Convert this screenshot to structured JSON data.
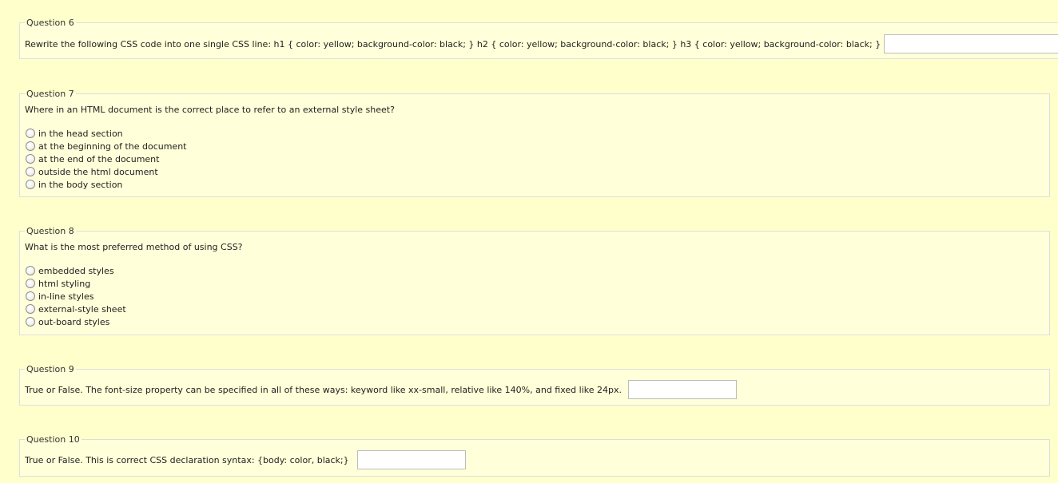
{
  "questions": {
    "q6": {
      "legend": "Question 6",
      "text": "Rewrite the following CSS code into one single CSS line: h1 { color: yellow; background-color: black; } h2 { color: yellow; background-color: black; } h3 { color: yellow; background-color: black; }",
      "answer": ""
    },
    "q7": {
      "legend": "Question 7",
      "text": "Where in an HTML document is the correct place to refer to an external style sheet?",
      "options": [
        "in the head section",
        "at the beginning of the document",
        "at the end of the document",
        "outside the html document",
        "in the body section"
      ]
    },
    "q8": {
      "legend": "Question 8",
      "text": "What is the most preferred method of using CSS?",
      "options": [
        "embedded styles",
        "html styling",
        "in-line styles",
        "external-style sheet",
        "out-board styles"
      ]
    },
    "q9": {
      "legend": "Question 9",
      "text": "True or False. The font-size property can be specified in all of these ways: keyword like xx-small, relative like 140%, and fixed like 24px.",
      "answer": ""
    },
    "q10": {
      "legend": "Question 10",
      "text": "True or False. This is correct CSS declaration syntax: {body: color, black;}",
      "answer": ""
    }
  },
  "colors": {
    "page_background": "#ffffcc",
    "fieldset_border": "#dedede"
  }
}
